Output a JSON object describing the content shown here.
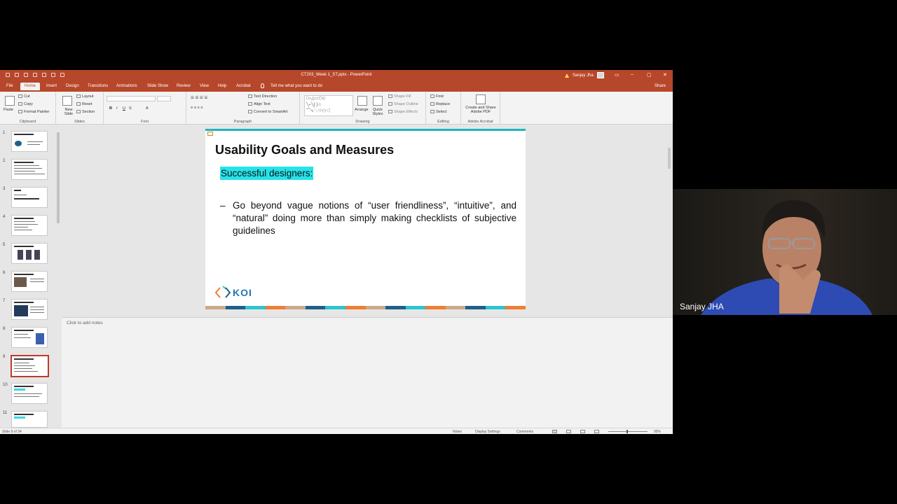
{
  "window": {
    "title": "CT203_Week 1_ST.pptx - PowerPoint",
    "user": "Sanjay Jha"
  },
  "tabs": [
    "File",
    "Home",
    "Insert",
    "Design",
    "Transitions",
    "Animations",
    "Slide Show",
    "Review",
    "View",
    "Help",
    "Acrobat"
  ],
  "tell_me": "Tell me what you want to do",
  "share": "Share",
  "ribbon": {
    "clipboard": {
      "paste": "Paste",
      "cut": "Cut",
      "copy": "Copy",
      "format_painter": "Format Painter",
      "label": "Clipboard"
    },
    "slides": {
      "new_slide": "New Slide",
      "layout": "Layout",
      "reset": "Reset",
      "section": "Section",
      "label": "Slides"
    },
    "font": {
      "label": "Font"
    },
    "paragraph": {
      "text_direction": "Text Direction",
      "align_text": "Align Text",
      "smartart": "Convert to SmartArt",
      "label": "Paragraph"
    },
    "drawing": {
      "arrange": "Arrange",
      "quick_styles": "Quick Styles",
      "shape_fill": "Shape Fill",
      "shape_outline": "Shape Outline",
      "shape_effects": "Shape Effects",
      "label": "Drawing"
    },
    "editing": {
      "find": "Find",
      "replace": "Replace",
      "select": "Select",
      "label": "Editing"
    },
    "acrobat": {
      "create_share": "Create and Share Adobe PDF",
      "label": "Adobe Acrobat"
    }
  },
  "thumbnails": [
    "1",
    "2",
    "3",
    "4",
    "5",
    "6",
    "7",
    "8",
    "9",
    "10",
    "11"
  ],
  "active_slide": 9,
  "slide": {
    "title": "Usability Goals and Measures",
    "highlight": "Successful designers:",
    "bullet_dash": "–",
    "bullet": "Go beyond vague notions of “user friendliness”, “intuitive”, and “natural” doing more than simply making checklists of subjective guidelines",
    "logo": "KOI"
  },
  "notes_placeholder": "Click to add notes",
  "status": {
    "slide_of": "Slide 9 of 34",
    "notes": "Notes",
    "display_settings": "Display Settings",
    "comments": "Comments",
    "zoom": "95%"
  },
  "video": {
    "name": "Sanjay JHA"
  },
  "colors": {
    "ppt_accent": "#b7472a",
    "highlight": "#25e3e9",
    "slide_top_rule": "#1fb5c0",
    "stripe": [
      "#c8a98a",
      "#1f5f8b",
      "#2bc4cf",
      "#f47c30",
      "#c8a98a",
      "#1f5f8b",
      "#2bc4cf",
      "#f47c30",
      "#c8a98a",
      "#1f5f8b",
      "#2bc4cf",
      "#f47c30",
      "#c8a98a",
      "#1f5f8b",
      "#2bc4cf",
      "#f47c30"
    ]
  }
}
